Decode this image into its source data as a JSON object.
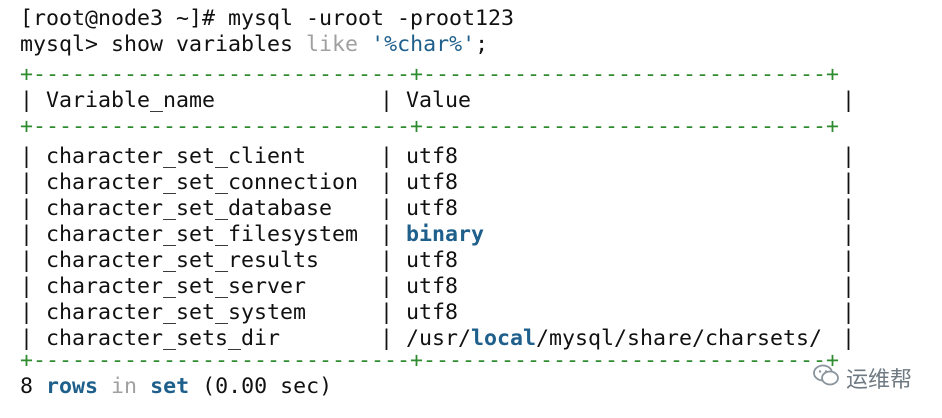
{
  "terminal": {
    "prompt1": "[root@node3 ~]# ",
    "cmd1": "mysql -uroot -proot123",
    "prompt2": "mysql> ",
    "cmd2_a": "show variables ",
    "cmd2_like": "like",
    "cmd2_space": " ",
    "cmd2_str": "'%char%'",
    "cmd2_end": ";",
    "border_line": "+-----------------------------+-------------------------------+",
    "header": {
      "col1": "Variable_name",
      "col2": "Value"
    },
    "rows": [
      {
        "name": "character_set_client",
        "value": "utf8"
      },
      {
        "name": "character_set_connection",
        "value": "utf8"
      },
      {
        "name": "character_set_database",
        "value": "utf8"
      },
      {
        "name": "character_set_filesystem",
        "value": "binary"
      },
      {
        "name": "character_set_results",
        "value": "utf8"
      },
      {
        "name": "character_set_server",
        "value": "utf8"
      },
      {
        "name": "character_set_system",
        "value": "utf8"
      },
      {
        "name": "character_sets_dir",
        "value_a": "/usr/",
        "value_kw": "local",
        "value_b": "/mysql/share/charsets/"
      }
    ],
    "footer": {
      "count": "8 ",
      "rows": "rows",
      "sp1": " ",
      "in": "in",
      "sp2": " ",
      "set": "set",
      "time": " (0.00 sec)"
    }
  },
  "watermark": {
    "icon": "wechat-icon",
    "text": "运维帮"
  },
  "colors": {
    "keyword_blue": "#1f5f8b",
    "keyword_gray": "#a0a0a0",
    "border_green": "#2e8b2e"
  }
}
